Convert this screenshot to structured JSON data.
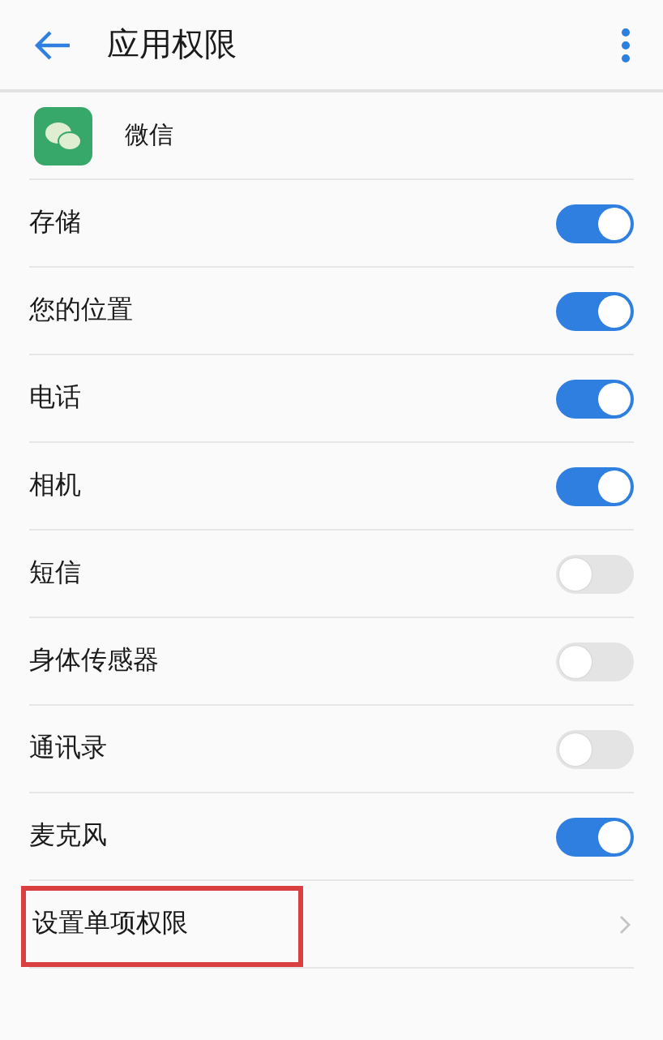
{
  "header": {
    "title": "应用权限"
  },
  "app": {
    "name": "微信"
  },
  "permissions": [
    {
      "label": "存储",
      "on": true
    },
    {
      "label": "您的位置",
      "on": true
    },
    {
      "label": "电话",
      "on": true
    },
    {
      "label": "相机",
      "on": true
    },
    {
      "label": "短信",
      "on": false
    },
    {
      "label": "身体传感器",
      "on": false
    },
    {
      "label": "通讯录",
      "on": false
    },
    {
      "label": "麦克风",
      "on": true
    }
  ],
  "link_row": {
    "label": "设置单项权限",
    "highlighted": true
  }
}
